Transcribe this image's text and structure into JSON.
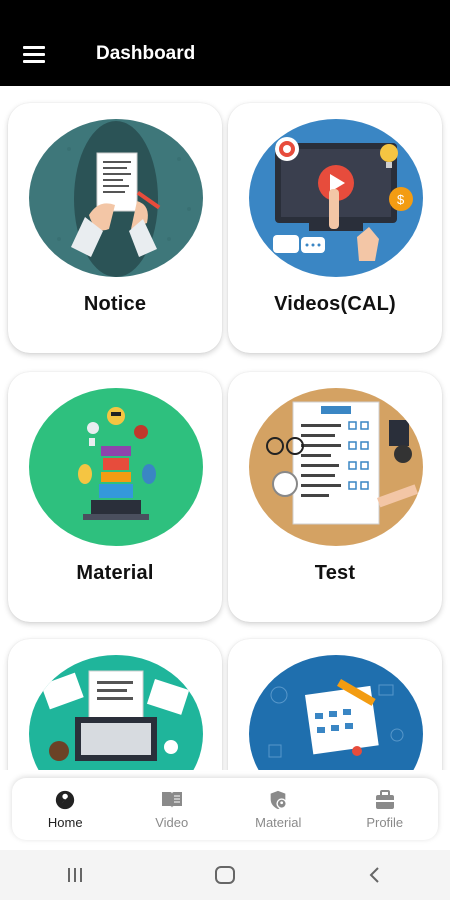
{
  "app": {
    "title": "Dashboard"
  },
  "icons": {
    "menu": "hamburger-menu-icon"
  },
  "cards": [
    {
      "label": "Notice",
      "art": "notice-illustration"
    },
    {
      "label": "Videos(CAL)",
      "art": "video-illustration"
    },
    {
      "label": "Material",
      "art": "material-illustration"
    },
    {
      "label": "Test",
      "art": "test-illustration"
    },
    {
      "label": "",
      "art": "laptop-desk-illustration"
    },
    {
      "label": "",
      "art": "calendar-planner-illustration"
    }
  ],
  "bottom_nav": {
    "active": "Home",
    "items": [
      {
        "label": "Home",
        "icon": "wrench-circle-icon"
      },
      {
        "label": "Video",
        "icon": "open-book-icon"
      },
      {
        "label": "Material",
        "icon": "shield-person-icon"
      },
      {
        "label": "Profile",
        "icon": "briefcase-icon"
      }
    ]
  },
  "system_nav": {
    "icons": [
      "recents-icon",
      "home-icon",
      "back-icon"
    ]
  },
  "colors": {
    "appbar": "#000000",
    "notice_bg": "#3e777a",
    "video_bg": "#3a86c4",
    "material_bg": "#2ec07e",
    "test_bg": "#d4a263",
    "laptop_bg": "#1fb59b",
    "calendar_bg": "#1f6fae"
  }
}
